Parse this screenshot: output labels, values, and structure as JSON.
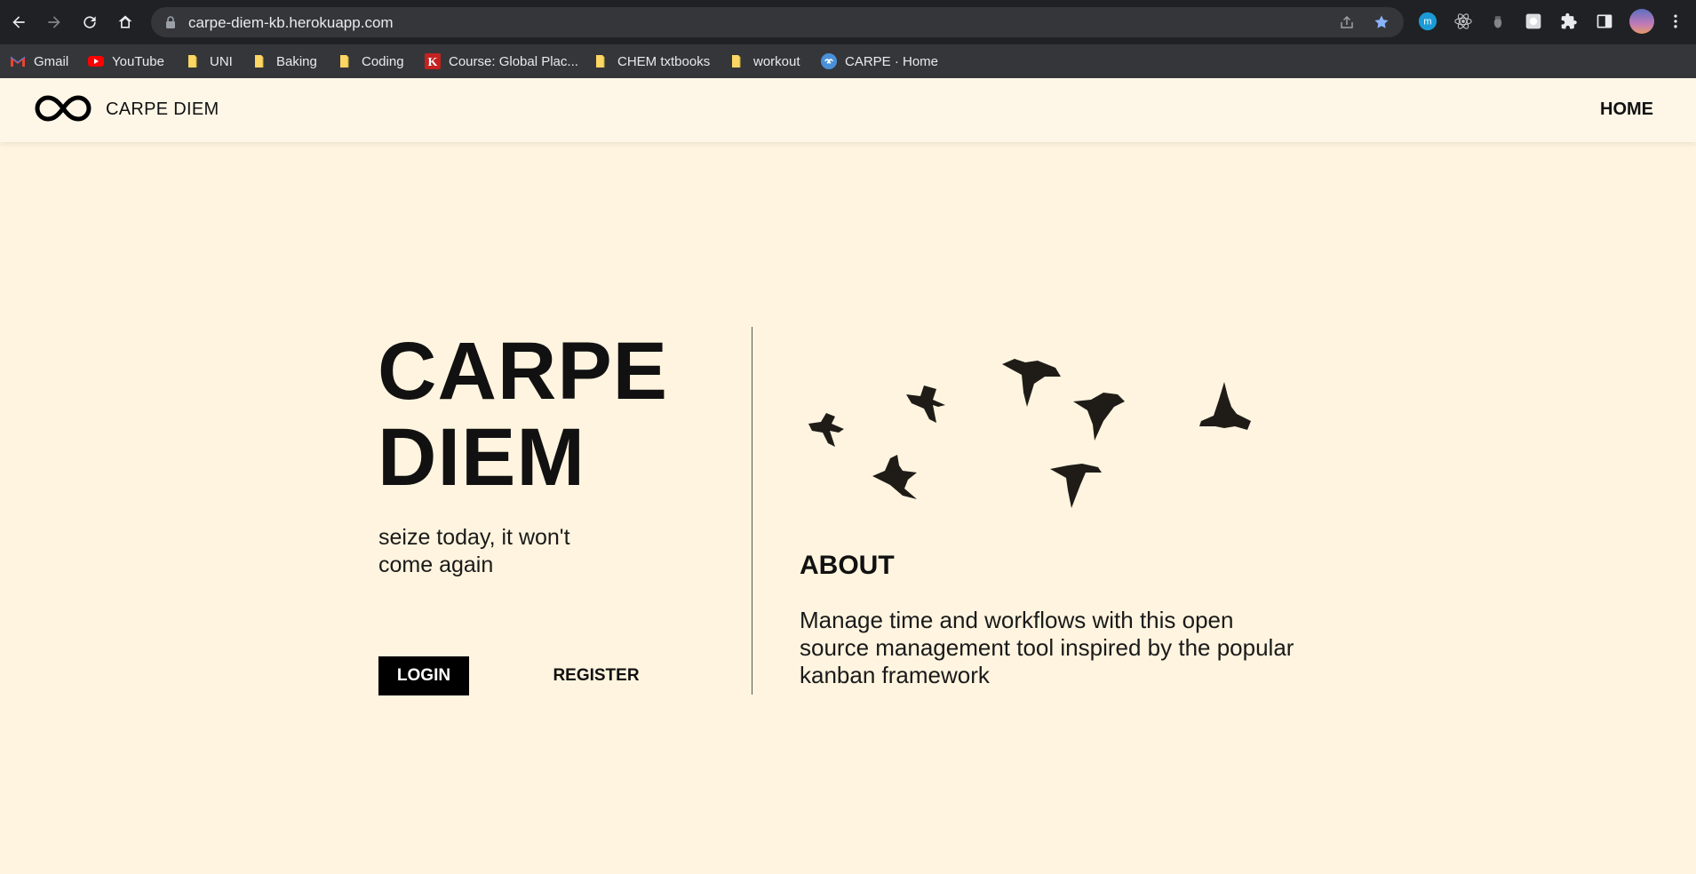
{
  "browser": {
    "url": "carpe-diem-kb.herokuapp.com",
    "bookmarks": [
      {
        "label": "Gmail",
        "icon": "gmail-icon"
      },
      {
        "label": "YouTube",
        "icon": "youtube-icon"
      },
      {
        "label": "UNI",
        "icon": "folder-icon"
      },
      {
        "label": "Baking",
        "icon": "folder-icon"
      },
      {
        "label": "Coding",
        "icon": "folder-icon"
      },
      {
        "label": "Course: Global Plac...",
        "icon": "k-icon"
      },
      {
        "label": "CHEM txtbooks",
        "icon": "folder-icon"
      },
      {
        "label": "workout",
        "icon": "folder-icon"
      },
      {
        "label": "CARPE · Home",
        "icon": "carpe-icon"
      }
    ]
  },
  "header": {
    "brand": "CARPE DIEM",
    "nav_home": "HOME"
  },
  "hero": {
    "title_line1": "CARPE",
    "title_line2": "DIEM",
    "subtitle": "seize today, it won't come again",
    "login_label": "LOGIN",
    "register_label": "REGISTER"
  },
  "about": {
    "title": "ABOUT",
    "text": "Manage time and workflows with this open source management tool inspired by the popular kanban framework"
  },
  "colors": {
    "page_bg": "#fef4df",
    "header_bg": "#fef7e8",
    "chrome_bg": "#202124",
    "bookmark_bar_bg": "#35363a",
    "accent_star": "#8ab4f8"
  }
}
